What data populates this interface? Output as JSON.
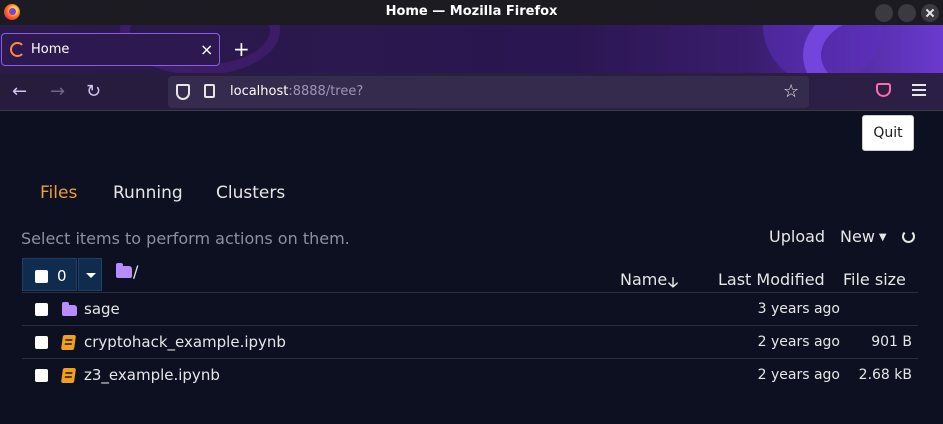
{
  "window": {
    "title": "Home — Mozilla Firefox"
  },
  "browser": {
    "tab_label": "Home",
    "tab_close": "×",
    "new_tab": "+",
    "url_host": "localhost",
    "url_rest": ":8888/tree?",
    "back": "←",
    "forward": "→",
    "reload": "↻",
    "bookmark": "☆"
  },
  "header": {
    "quit_label": "Quit"
  },
  "tabs": {
    "files": "Files",
    "running": "Running",
    "clusters": "Clusters"
  },
  "toolbar": {
    "hint": "Select items to perform actions on them.",
    "upload_label": "Upload",
    "new_label": "New",
    "selected_count": "0",
    "breadcrumb_root": "/"
  },
  "columns": {
    "name": "Name",
    "sort_arrow": "🡣",
    "last_modified": "Last Modified",
    "file_size": "File size"
  },
  "files": [
    {
      "name": "sage",
      "type": "folder",
      "modified": "3 years ago",
      "size": ""
    },
    {
      "name": "cryptohack_example.ipynb",
      "type": "notebook",
      "modified": "2 years ago",
      "size": "901 B"
    },
    {
      "name": "z3_example.ipynb",
      "type": "notebook",
      "modified": "2 years ago",
      "size": "2.68 kB"
    }
  ],
  "colors": {
    "accent_tab": "#f0a030",
    "folder": "#b68cff",
    "notebook": "#f0a020",
    "background": "#0c1021"
  }
}
